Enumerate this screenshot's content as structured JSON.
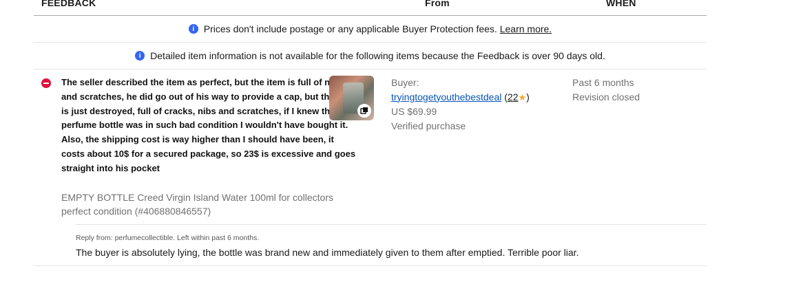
{
  "table_header": {
    "feedback": "FEEDBACK",
    "from": "From",
    "when": "WHEN"
  },
  "notices": [
    {
      "icon": "info-icon",
      "text": "Prices don't include postage or any applicable Buyer Protection fees.",
      "link": "Learn more."
    },
    {
      "icon": "info-icon",
      "text": "Detailed item information is not available for the following items because the Feedback is over 90 days old."
    }
  ],
  "feedback": {
    "rating_icon": "negative-icon",
    "comment": "The seller described the item as perfect, but the item is full of nibs and scratches, he did go out of his way to provide a cap, but the cap is just destroyed, full of cracks, nibs and scratches, if I knew the perfume bottle was in such bad condition I wouldn't have bought it. Also, the shipping cost is way higher than I should have been, it costs about 10$ for a secured package, so 23$ is excessive and goes straight into his pocket",
    "item_title": "EMPTY BOTTLE Creed Virgin Island Water 100ml for collectors perfect condition (#406880846557)",
    "thumbnail_icon": "gallery-icon",
    "from": {
      "role": "Buyer:",
      "username": "tryingtogetyouthebestdeal",
      "score_open": "(",
      "score": "22",
      "star": "★",
      "score_close": ")",
      "price": "US $69.99",
      "verified": "Verified purchase"
    },
    "when": {
      "time": "Past 6 months",
      "status": "Revision closed"
    }
  },
  "reply": {
    "meta": "Reply from: perfumecollectible. Left within past 6 months.",
    "text": "The buyer is absolutely lying, the bottle was brand new and immediately given to them after emptied. Terrible poor liar."
  },
  "colors": {
    "link": "#0654ba",
    "info": "#3665f3",
    "negative": "#e0103a",
    "star": "#f5a623"
  }
}
